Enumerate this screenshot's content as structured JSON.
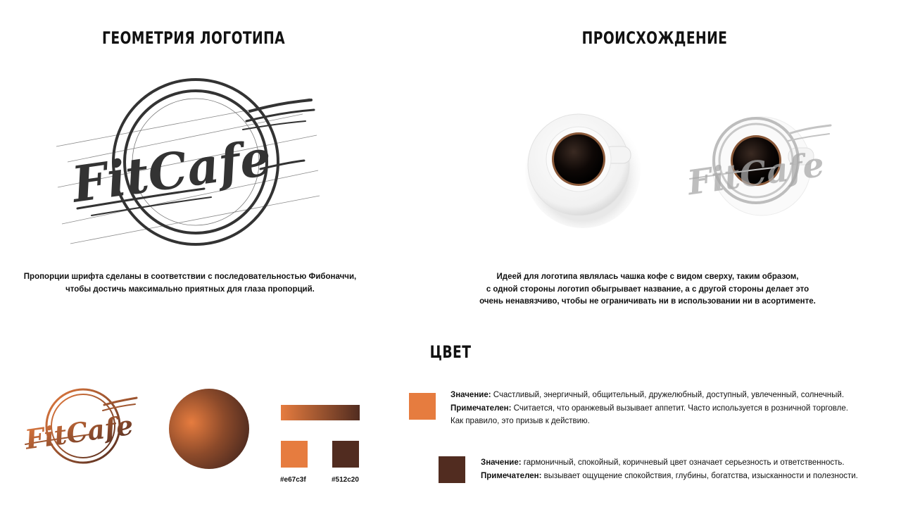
{
  "sections": {
    "geometry_title": "ГЕОМЕТРИЯ ЛОГОТИПА",
    "origin_title": "ПРОИСХОЖДЕНИЕ",
    "color_title": "ЦВЕТ"
  },
  "logo_text": "FitCafe",
  "geometry_caption": {
    "line1": "Пропорции шрифта сделаны в соответствии с последовательностью Фибоначчи,",
    "line2": "чтобы  достичь максимально приятных для глаза пропорций."
  },
  "origin_caption": {
    "line1": "Идеей для логотипа являлась чашка кофе с видом сверху, таким образом,",
    "line2": "с одной стороны логотип обыгрывает название, а с другой стороны делает это",
    "line3": "очень ненавязчиво, чтобы не ограничивать ни в использовании ни в асортименте."
  },
  "colors": {
    "orange": "#e67c3f",
    "brown": "#512c20",
    "orange_label": "#e67c3f",
    "brown_label": "#512c20"
  },
  "orange_note": {
    "meaning_label": "Значение:",
    "meaning_text": " Счастливый, энергичный, общительный, дружелюбный, доступный, увлеченный, солнечный.",
    "notable_label": "Примечателен:",
    "notable_text": " Считается, что оранжевый вызывает аппетит. Часто используется в розничной торговле.",
    "line3": "Как правило, это призыв к действию."
  },
  "brown_note": {
    "meaning_label": "Значение:",
    "meaning_text": " гармоничный, спокойный, коричневый цвет означает серьезность и ответственность.",
    "notable_label": "Примечателен:",
    "notable_text": " вызывает ощущение спокойствия, глубины, богатства, изысканности и полезности."
  }
}
